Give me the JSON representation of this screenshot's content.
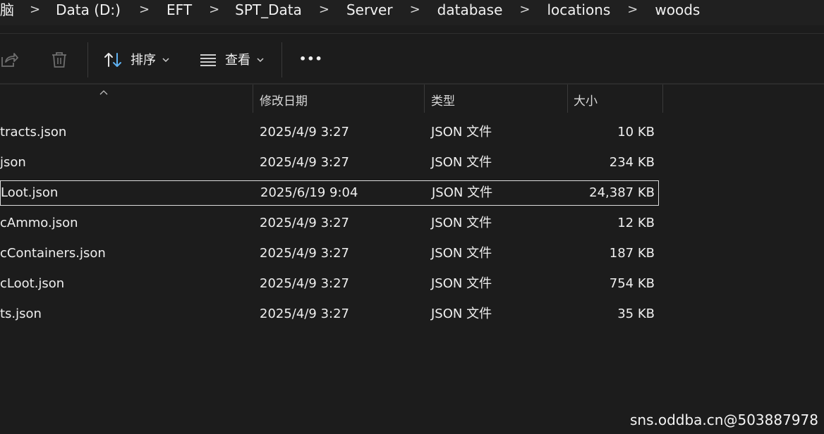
{
  "breadcrumb": {
    "items": [
      "脑",
      "Data (D:)",
      "EFT",
      "SPT_Data",
      "Server",
      "database",
      "locations",
      "woods"
    ],
    "separator": ">"
  },
  "toolbar": {
    "share_icon": "share-icon",
    "delete_icon": "trash-icon",
    "sort_label": "排序",
    "view_label": "查看",
    "more_label": "•••"
  },
  "columns": {
    "date": "修改日期",
    "type": "类型",
    "size": "大小"
  },
  "files": [
    {
      "name": "tracts.json",
      "date": "2025/4/9 3:27",
      "type": "JSON 文件",
      "size": "10 KB"
    },
    {
      "name": "json",
      "date": "2025/4/9 3:27",
      "type": "JSON 文件",
      "size": "234 KB"
    },
    {
      "name": "Loot.json",
      "date": "2025/6/19 9:04",
      "type": "JSON 文件",
      "size": "24,387 KB"
    },
    {
      "name": "cAmmo.json",
      "date": "2025/4/9 3:27",
      "type": "JSON 文件",
      "size": "12 KB"
    },
    {
      "name": "cContainers.json",
      "date": "2025/4/9 3:27",
      "type": "JSON 文件",
      "size": "187 KB"
    },
    {
      "name": "cLoot.json",
      "date": "2025/4/9 3:27",
      "type": "JSON 文件",
      "size": "754 KB"
    },
    {
      "name": "ts.json",
      "date": "2025/4/9 3:27",
      "type": "JSON 文件",
      "size": "35 KB"
    }
  ],
  "watermark": "sns.oddba.cn@503887978",
  "colors": {
    "background": "#1c1c1c",
    "address_bar": "#202020",
    "text": "#efefef",
    "selection_border": "#dcdcdc",
    "sort_icon_accent": "#5fb2f2"
  }
}
